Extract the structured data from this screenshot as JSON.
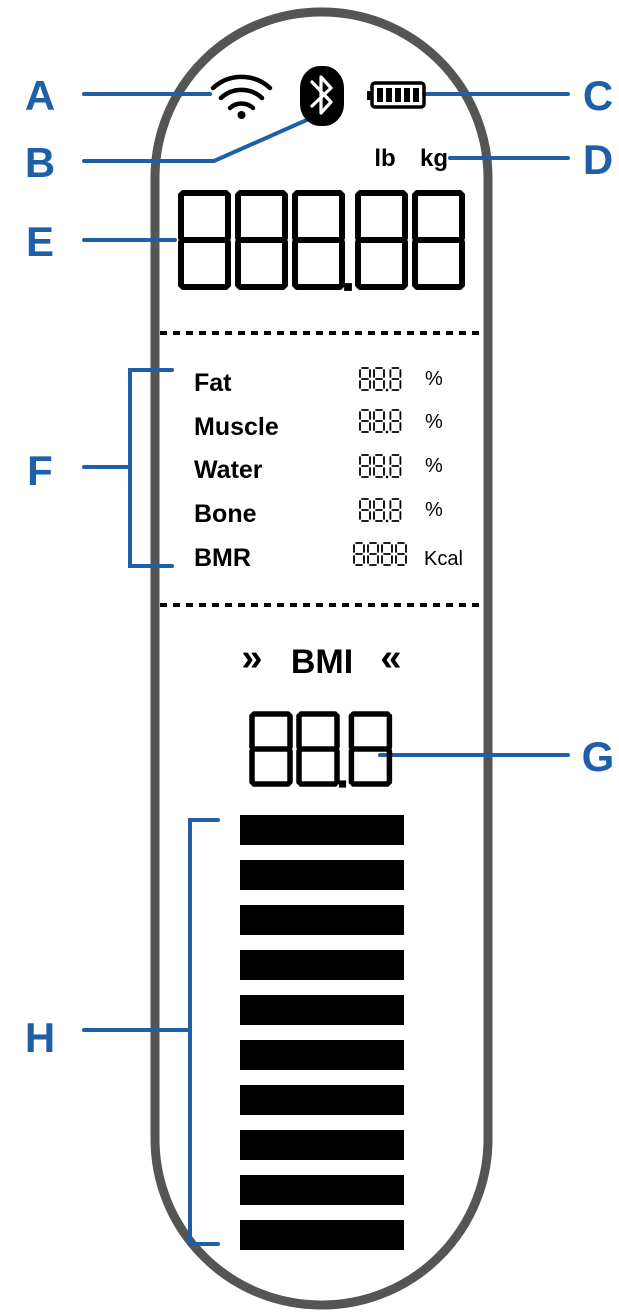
{
  "callouts": {
    "a": "A",
    "b": "B",
    "c": "C",
    "d": "D",
    "e": "E",
    "f": "F",
    "g": "G",
    "h": "H"
  },
  "units": {
    "lb": "lb",
    "kg": "kg"
  },
  "main_display": {
    "digits": "888.88"
  },
  "metrics": [
    {
      "label": "Fat",
      "digits": "88.8",
      "unit": "%"
    },
    {
      "label": "Muscle",
      "digits": "88.8",
      "unit": "%"
    },
    {
      "label": "Water",
      "digits": "88.8",
      "unit": "%"
    },
    {
      "label": "Bone",
      "digits": "88.8",
      "unit": "%"
    },
    {
      "label": "BMR",
      "digits": "8888",
      "unit": "Kcal"
    }
  ],
  "bmi": {
    "chevron_left": "»",
    "title": "BMI",
    "chevron_right": "«",
    "digits": "88.8"
  },
  "bmi_bars": {
    "segments": 10
  },
  "icons": {
    "wifi": "wifi-icon",
    "bluetooth": "bluetooth-icon",
    "battery": "battery-icon"
  },
  "colors": {
    "callout": "#1e5fa8",
    "outline": "#555555",
    "segment": "#000000",
    "divider": "#000000"
  }
}
